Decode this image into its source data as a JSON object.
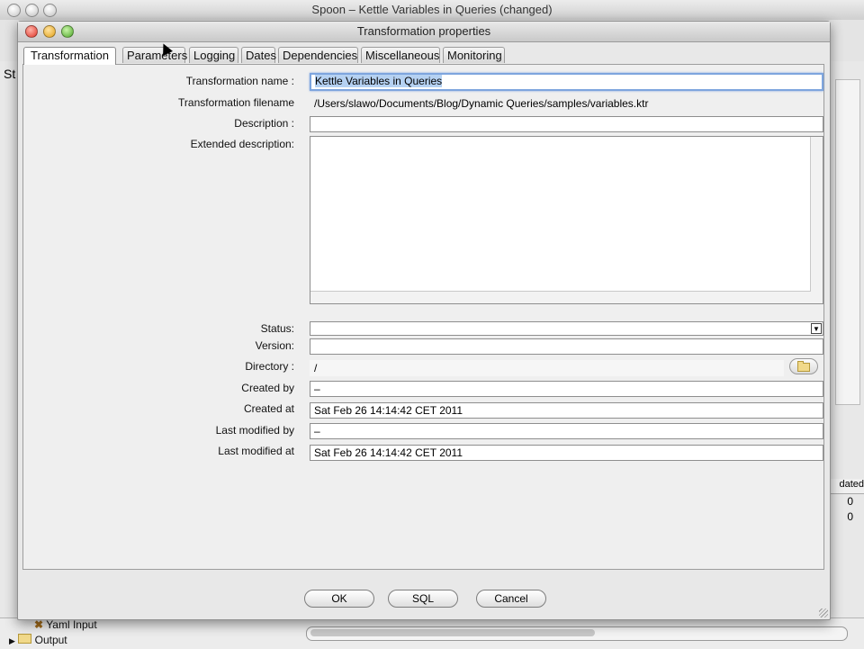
{
  "main_window": {
    "title": "Spoon – Kettle Variables in Queries (changed)",
    "left_label": "St",
    "right_header": "dated",
    "right_values": [
      "0",
      "0"
    ],
    "tree_items": [
      "Yaml Input",
      "Output"
    ]
  },
  "dialog": {
    "title": "Transformation properties",
    "tabs": [
      {
        "label": "Transformation",
        "active": true
      },
      {
        "label": "Parameters",
        "active": false
      },
      {
        "label": "Logging",
        "active": false
      },
      {
        "label": "Dates",
        "active": false
      },
      {
        "label": "Dependencies",
        "active": false
      },
      {
        "label": "Miscellaneous",
        "active": false
      },
      {
        "label": "Monitoring",
        "active": false
      }
    ],
    "fields": {
      "name_label": "Transformation name :",
      "name_value": "Kettle Variables in Queries",
      "filename_label": "Transformation filename",
      "filename_value": "/Users/slawo/Documents/Blog/Dynamic Queries/samples/variables.ktr",
      "description_label": "Description :",
      "description_value": "",
      "ext_description_label": "Extended description:",
      "ext_description_value": "",
      "status_label": "Status:",
      "status_value": "",
      "version_label": "Version:",
      "version_value": "",
      "directory_label": "Directory :",
      "directory_value": "/",
      "created_by_label": "Created by",
      "created_by_value": "–",
      "created_at_label": "Created at",
      "created_at_value": "Sat Feb 26 14:14:42 CET 2011",
      "modified_by_label": "Last modified by",
      "modified_by_value": "–",
      "modified_at_label": "Last modified at",
      "modified_at_value": "Sat Feb 26 14:14:42 CET 2011"
    },
    "buttons": {
      "ok": "OK",
      "sql": "SQL",
      "cancel": "Cancel"
    }
  },
  "colors": {
    "selection": "#b5d1f2",
    "focus_ring": "#7ea5de"
  }
}
